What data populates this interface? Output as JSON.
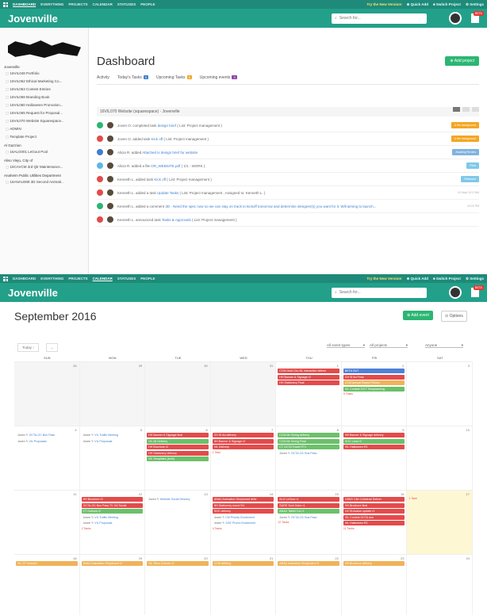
{
  "top_nav": {
    "items": [
      "DASHBOARD",
      "EVERYTHING",
      "PROJECTS",
      "CALENDAR",
      "STATUSES",
      "PEOPLE"
    ],
    "upgrade": "Try the New Version!",
    "quick_add": "Quick Add",
    "switch_project": "Switch Project",
    "settings": "Settings"
  },
  "app": {
    "name": "Jovenville",
    "search_placeholder": "Search for...",
    "notif_badge": "BETA"
  },
  "sidebar": {
    "client": "Jovenville",
    "items": [
      {
        "type": "group",
        "label": "Jovenville"
      },
      {
        "type": "item",
        "label": "16VIL048 Portfolio"
      },
      {
        "type": "item",
        "label": "16VIL052 Ethical Marketing Co..."
      },
      {
        "type": "item",
        "label": "16VIL053 Contest Entries"
      },
      {
        "type": "item",
        "label": "16VIL058 Branding Book"
      },
      {
        "type": "item",
        "label": "16VIL060 Halloween Promotion..."
      },
      {
        "type": "item",
        "label": "16VIL065 Request for Proposal..."
      },
      {
        "type": "item",
        "label": "16VIL070 Website Squarespace..."
      },
      {
        "type": "item",
        "label": "ADMIN"
      },
      {
        "type": "item",
        "label": "Template Project"
      },
      {
        "type": "group",
        "label": "Al Gazzion"
      },
      {
        "type": "item",
        "label": "16ALG001 LeGout Pool"
      },
      {
        "type": "group",
        "label": "Aliso Viejo, City of"
      },
      {
        "type": "item",
        "label": "16CAVCM 3rd Qtr Maintenance..."
      },
      {
        "type": "group",
        "label": "Anaheim Public Utilities Department"
      },
      {
        "type": "item",
        "label": "16ANAU008 3D Second Animati..."
      }
    ]
  },
  "dashboard": {
    "title": "Dashboard",
    "add_project": "Add project",
    "tabs": [
      {
        "label": "Activity",
        "badge": ""
      },
      {
        "label": "Today's Tasks",
        "badge": "0"
      },
      {
        "label": "Upcoming Tasks",
        "badge": "8"
      },
      {
        "label": "Upcoming events",
        "badge": "3"
      }
    ],
    "group_header": "16VIL070 Website (squarespace) · Jovenville",
    "feed": [
      {
        "status": "#2bb673",
        "text": "Joven O. completed task",
        "link": "design brief",
        "rest": "( List: Project management )",
        "tag": "A the background",
        "tag_color": "#f5a623"
      },
      {
        "status": "#e34b4b",
        "text": "Joven O. added task",
        "link": "Kick off",
        "rest": "( List: Project management )",
        "tag": "A the background",
        "tag_color": "#f5a623"
      },
      {
        "status": "#3f7fd0",
        "text": "Alicia R. added",
        "link": "Attached is design brief for website",
        "rest": "",
        "tag": "Awaiting Review",
        "tag_color": "#7fb3e0"
      },
      {
        "status": "#5bb8e6",
        "text": "Alicia R. added a file",
        "link": "OR_WEBSITE.pdf",
        "rest": "( 1/1 - WORK )",
        "tag": "Filed",
        "tag_color": "#7fc9e8"
      },
      {
        "status": "#e34b4b",
        "text": "Kenneth L. added task",
        "link": "Kick off",
        "rest": "( List: Project management )",
        "tag": "Released",
        "tag_color": "#7fc9e8"
      },
      {
        "status": "#e34b4b",
        "text": "Kenneth L. added a task",
        "link": "Update Tasks",
        "rest": "( List: Project management , Assigned to: Kenneth L. )",
        "time": "19 Sept 10:17AM"
      },
      {
        "status": "#2bb673",
        "text": "Kenneth L. added a comment",
        "link": "3D - Need the spec now so we can stay on track to kickoff tomorrow and determine designer(s) you want for it. Will aiming to launch...",
        "rest": "",
        "time": "10:22 PM"
      },
      {
        "status": "#e34b4b",
        "text": "Kenneth L. announced task",
        "link": "Tasks & Approvals",
        "rest": "( List: Project management )",
        "time": ""
      }
    ]
  },
  "calendar": {
    "title": "September 2016",
    "add_event": "Add event",
    "options": "Options",
    "today": "Today",
    "filters": [
      "All event types",
      "All projects",
      "Anyone"
    ],
    "weekdays": [
      "SUN",
      "MON",
      "TUE",
      "WED",
      "THU",
      "FRI",
      "SAT"
    ],
    "weeks": [
      [
        {
          "num": "28",
          "in": false,
          "events": []
        },
        {
          "num": "29",
          "in": false,
          "events": []
        },
        {
          "num": "30",
          "in": false,
          "events": []
        },
        {
          "num": "31",
          "in": false,
          "events": []
        },
        {
          "num": "1",
          "in": true,
          "events": [
            {
              "c": "red",
              "t": "CCM Gold Circ NL Interactive deliver"
            },
            {
              "c": "red",
              "t": "HH Banner & Signage r2"
            },
            {
              "c": "red",
              "t": "HH Stationery Final"
            }
          ]
        },
        {
          "num": "2",
          "in": true,
          "events": [
            {
              "c": "blue",
              "t": "BETA OUT"
            },
            {
              "c": "red",
              "t": "CH Sf Ad Final"
            },
            {
              "c": "orange",
              "t": "CCM Annual Report Pieces"
            },
            {
              "c": "green",
              "t": "VIL Contest 2017 Timeplanning"
            }
          ],
          "more": "5 Tasks"
        },
        {
          "num": "3",
          "in": true,
          "events": []
        }
      ],
      [
        {
          "num": "4",
          "in": true,
          "events": [
            {
              "c": "plain",
              "t": "OCTA-OC Bus Pass",
              "pre": "Joven ✎"
            },
            {
              "c": "plain",
              "t": "VIL Proposals",
              "pre": "Joven ✎"
            }
          ]
        },
        {
          "num": "5",
          "in": true,
          "events": [
            {
              "c": "plain",
              "t": "VIL Traffic Meeting",
              "pre": "Joven ✎"
            },
            {
              "c": "plain",
              "t": "VIL Proposals",
              "pre": "Joven ✎"
            }
          ]
        },
        {
          "num": "6",
          "in": true,
          "events": [
            {
              "c": "red",
              "t": "HH Banner & Signage final"
            },
            {
              "c": "green",
              "t": "VIL All Delivery"
            },
            {
              "c": "red",
              "t": "HH Brochure r2"
            },
            {
              "c": "red",
              "t": "HH Stationery delivery"
            },
            {
              "c": "green",
              "t": "VIL Templates (both)"
            }
          ]
        },
        {
          "num": "7",
          "in": true,
          "events": [
            {
              "c": "red",
              "t": "CH Sf Ad delivery"
            },
            {
              "c": "red",
              "t": "HH Banner & Signage r3"
            },
            {
              "c": "red",
              "t": "VIL Delivery"
            }
          ],
          "more": "1 Task"
        },
        {
          "num": "8",
          "in": true,
          "events": [
            {
              "c": "green",
              "t": "CCM Mr Giving delivery"
            },
            {
              "c": "green",
              "t": "CCM Mr Giving Final"
            },
            {
              "c": "green",
              "t": "CT OCTA Travel RT1"
            },
            {
              "c": "plain",
              "t": "OCTA-OC Bus Pass",
              "pre": "Joven ✎"
            }
          ]
        },
        {
          "num": "9",
          "in": true,
          "events": [
            {
              "c": "red",
              "t": "HH Banner & Signage delivery"
            },
            {
              "c": "green",
              "t": "SOC Lead r2"
            },
            {
              "c": "red",
              "t": "VIL Halloween R1"
            }
          ]
        },
        {
          "num": "10",
          "in": true,
          "events": []
        }
      ],
      [
        {
          "num": "11",
          "in": true,
          "events": []
        },
        {
          "num": "12",
          "in": true,
          "events": [
            {
              "c": "red",
              "t": "HH Brochure r3"
            },
            {
              "c": "red",
              "t": "OCTA-OC Bus Pass TV 3/4 Social"
            },
            {
              "c": "green",
              "t": "CT Outlook r2"
            },
            {
              "c": "plain",
              "t": "VIL Traffic Meeting",
              "pre": "Joven ✎"
            },
            {
              "c": "plain",
              "t": "VIL Proposals",
              "pre": "Joven ✎"
            }
          ],
          "more": "2 Tasks"
        },
        {
          "num": "13",
          "in": true,
          "events": [
            {
              "c": "plain",
              "t": "Website Social Delivery",
              "pre": "Joven ✎"
            }
          ]
        },
        {
          "num": "14",
          "in": true,
          "events": [
            {
              "c": "red",
              "t": "ANAU Animation Storyboard deliv"
            },
            {
              "c": "red",
              "t": "HH Stationery round R4"
            },
            {
              "c": "red",
              "t": "SOC delivery"
            },
            {
              "c": "plain",
              "t": "CM Priority Excitement",
              "pre": "Joven ✎"
            },
            {
              "c": "plain",
              "t": "SGE Promo Excitement",
              "pre": "Joven ✎"
            }
          ],
          "more": "4 Tasks"
        },
        {
          "num": "15",
          "in": true,
          "events": [
            {
              "c": "red",
              "t": "ALG LeGout r1"
            },
            {
              "c": "red",
              "t": "SURE Scot Gator r1"
            },
            {
              "c": "green",
              "t": "ANAU Tablet Cut r1"
            },
            {
              "c": "plain",
              "t": "OCTA-OC Bus Pass",
              "pre": "Joven ✎"
            }
          ],
          "more": "12 Tasks"
        },
        {
          "num": "16",
          "in": true,
          "events": [
            {
              "c": "red",
              "t": "CBMY Cite Collateral Deliver"
            },
            {
              "c": "red",
              "t": "HH Brochure final"
            },
            {
              "c": "red",
              "t": "OCTA Avalon update r1"
            },
            {
              "c": "red",
              "t": "VIL Contest OCTA due"
            },
            {
              "c": "red",
              "t": "VIL Halloween R2"
            }
          ],
          "more": "11 Tasks"
        },
        {
          "num": "17",
          "in": true,
          "today": true,
          "events": [],
          "more": "1 Task"
        }
      ],
      [
        {
          "num": "18",
          "in": true,
          "events": [
            {
              "c": "orange",
              "t": "VIL OT revision"
            }
          ]
        },
        {
          "num": "19",
          "in": true,
          "events": [
            {
              "c": "orange",
              "t": "ANAU Animation Storyboard r2"
            }
          ]
        },
        {
          "num": "20",
          "in": true,
          "events": [
            {
              "c": "orange",
              "t": "VIL Telco Cutover r1"
            }
          ]
        },
        {
          "num": "21",
          "in": true,
          "events": [
            {
              "c": "orange",
              "t": "CCM delivery"
            }
          ]
        },
        {
          "num": "22",
          "in": true,
          "events": [
            {
              "c": "orange",
              "t": "ANAU Animation Storyboard r3"
            }
          ]
        },
        {
          "num": "23",
          "in": true,
          "events": [
            {
              "c": "orange",
              "t": "HH Brochure delivery"
            }
          ]
        },
        {
          "num": "24",
          "in": true,
          "events": []
        }
      ]
    ]
  },
  "colors": {
    "brand": "#23a08a",
    "nav": "#1f8a79",
    "green": "#2bb673",
    "red": "#e34b4b",
    "today": "#fdf7d4"
  }
}
